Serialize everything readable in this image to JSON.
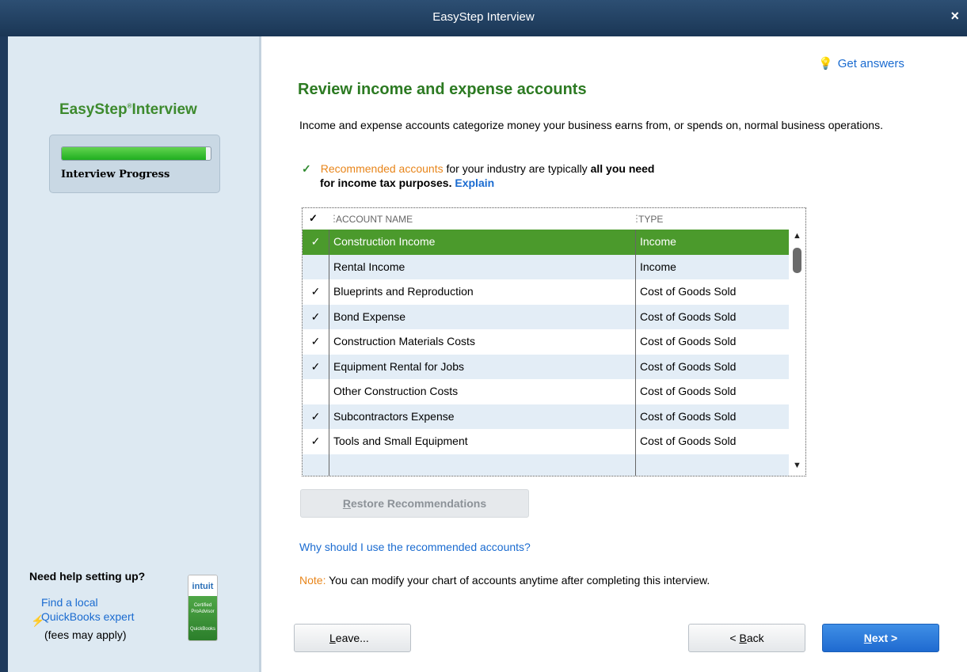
{
  "window": {
    "title": "EasyStep Interview",
    "close_glyph": "×"
  },
  "sidebar": {
    "brand": "EasyStep",
    "brand_tm": "®",
    "brand_suffix": "Interview",
    "progress": {
      "label": "Interview Progress",
      "fraction": 0.97
    },
    "help": {
      "title": "Need help setting up?",
      "link_line1": "Find a local",
      "link_line2": "QuickBooks expert",
      "fees": "(fees may apply)",
      "badge_top": "intuit",
      "badge_line1": "Certified",
      "badge_line2": "ProAdvisor",
      "badge_line3": "QuickBooks"
    }
  },
  "main": {
    "get_answers": "Get answers",
    "title": "Review income and expense accounts",
    "intro": "Income and expense accounts categorize money your business earns from, or spends on, normal business operations.",
    "recommended": {
      "check": "✓",
      "orange": "Recommended accounts",
      "rest": " for your industry are typically ",
      "bold1": "all you need",
      "line2_bold": "for income tax purposes.",
      "explain": "Explain"
    },
    "grid": {
      "header_check": "✓",
      "col_name": "ACCOUNT NAME",
      "col_type": "TYPE",
      "rows": [
        {
          "check": "✓",
          "name": "Construction Income",
          "type": "Income"
        },
        {
          "check": "",
          "name": "Rental Income",
          "type": "Income"
        },
        {
          "check": "✓",
          "name": "Blueprints and Reproduction",
          "type": "Cost of Goods Sold"
        },
        {
          "check": "✓",
          "name": "Bond Expense",
          "type": "Cost of Goods Sold"
        },
        {
          "check": "✓",
          "name": "Construction Materials Costs",
          "type": "Cost of Goods Sold"
        },
        {
          "check": "✓",
          "name": "Equipment Rental for Jobs",
          "type": "Cost of Goods Sold"
        },
        {
          "check": "",
          "name": "Other Construction Costs",
          "type": "Cost of Goods Sold"
        },
        {
          "check": "✓",
          "name": "Subcontractors Expense",
          "type": "Cost of Goods Sold"
        },
        {
          "check": "✓",
          "name": "Tools and Small Equipment",
          "type": "Cost of Goods Sold"
        },
        {
          "check": "",
          "name": "",
          "type": ""
        }
      ]
    },
    "restore_button_first": "R",
    "restore_button_rest": "estore Recommendations",
    "why_link": "Why should I use the recommended accounts?",
    "note_label": "Note:",
    "note_text": " You can modify your chart of accounts anytime after completing this interview.",
    "buttons": {
      "leave_first": "L",
      "leave_rest": "eave...",
      "back_pre": "< ",
      "back_first": "B",
      "back_rest": "ack",
      "next_first": "N",
      "next_rest": "ext >"
    }
  }
}
